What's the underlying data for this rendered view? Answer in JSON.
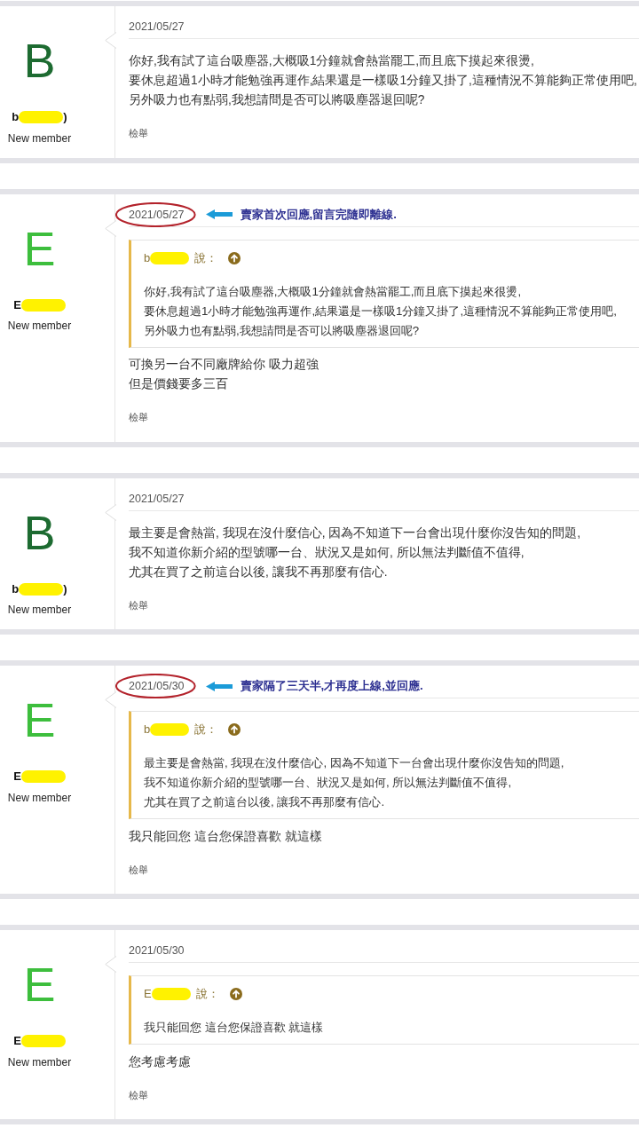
{
  "posts": [
    {
      "author": {
        "initial": "B",
        "color": "#1d6b31",
        "name": "b",
        "redacted": true,
        "name_tail": ")",
        "rank": "New member"
      },
      "date": "2021/05/27",
      "date_circled": false,
      "body": [
        "你好,我有試了這台吸塵器,大概吸1分鐘就會熱當罷工,而且底下摸起來很燙,",
        "要休息超過1小時才能勉強再運作,結果還是一樣吸1分鐘又掛了,這種情況不算能夠正常使用吧,",
        "另外吸力也有點弱,我想請問是否可以將吸塵器退回呢?"
      ],
      "report": "檢舉"
    },
    {
      "author": {
        "initial": "E",
        "color": "#3dbe3d",
        "name": "E",
        "redacted": true,
        "rank": "New member"
      },
      "date": "2021/05/27",
      "date_circled": true,
      "annotation": "賣家首次回應,留言完隨即離線.",
      "quote": {
        "author": "b",
        "redacted": true,
        "says": "說：",
        "lines": [
          "你好,我有試了這台吸塵器,大概吸1分鐘就會熱當罷工,而且底下摸起來很燙,",
          "要休息超過1小時才能勉強再運作,結果還是一樣吸1分鐘又掛了,這種情況不算能夠正常使用吧,",
          "另外吸力也有點弱,我想請問是否可以將吸塵器退回呢?"
        ]
      },
      "body": [
        "可換另一台不同廠牌給你 吸力超強",
        "但是價錢要多三百"
      ],
      "report": "檢舉"
    },
    {
      "author": {
        "initial": "B",
        "color": "#1d6b31",
        "name": "b",
        "redacted": true,
        "name_tail": ")",
        "rank": "New member"
      },
      "date": "2021/05/27",
      "date_circled": false,
      "body": [
        "最主要是會熱當, 我現在沒什麼信心, 因為不知道下一台會出現什麼你沒告知的問題,",
        "我不知道你新介紹的型號哪一台、狀況又是如何, 所以無法判斷值不值得,",
        "尤其在買了之前這台以後, 讓我不再那麼有信心."
      ],
      "report": "檢舉"
    },
    {
      "author": {
        "initial": "E",
        "color": "#3dbe3d",
        "name": "E",
        "redacted": true,
        "rank": "New member"
      },
      "date": "2021/05/30",
      "date_circled": true,
      "annotation": "賣家隔了三天半,才再度上線,並回應.",
      "quote": {
        "author": "b",
        "redacted": true,
        "says": "說：",
        "lines": [
          "最主要是會熱當, 我現在沒什麼信心, 因為不知道下一台會出現什麼你沒告知的問題,",
          "我不知道你新介紹的型號哪一台、狀況又是如何, 所以無法判斷值不值得,",
          "尤其在買了之前這台以後, 讓我不再那麼有信心."
        ]
      },
      "body": [
        "我只能回您 這台您保證喜歡 就這樣"
      ],
      "report": "檢舉"
    },
    {
      "author": {
        "initial": "E",
        "color": "#3dbe3d",
        "name": "E",
        "redacted": true,
        "rank": "New member"
      },
      "date": "2021/05/30",
      "date_circled": false,
      "quote": {
        "author": "E",
        "redacted": true,
        "says": "說：",
        "lines": [
          "我只能回您 這台您保證喜歡 就這樣"
        ]
      },
      "body": [
        "您考慮考慮"
      ],
      "report": "檢舉"
    }
  ]
}
